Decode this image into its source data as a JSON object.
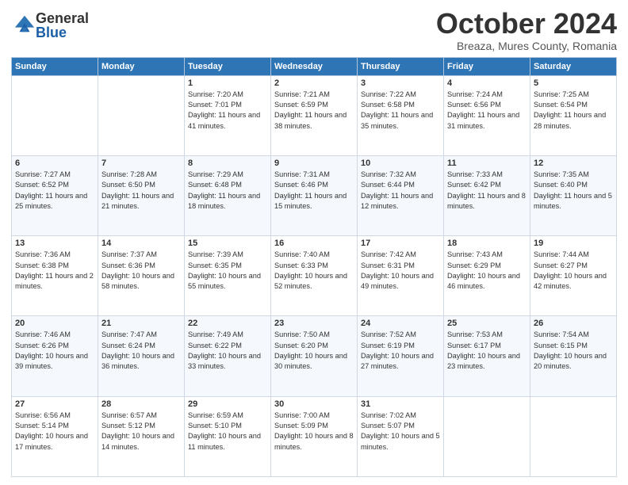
{
  "header": {
    "logo_general": "General",
    "logo_blue": "Blue",
    "month_title": "October 2024",
    "location": "Breaza, Mures County, Romania"
  },
  "days_of_week": [
    "Sunday",
    "Monday",
    "Tuesday",
    "Wednesday",
    "Thursday",
    "Friday",
    "Saturday"
  ],
  "weeks": [
    [
      {
        "day": "",
        "sunrise": "",
        "sunset": "",
        "daylight": ""
      },
      {
        "day": "",
        "sunrise": "",
        "sunset": "",
        "daylight": ""
      },
      {
        "day": "1",
        "sunrise": "Sunrise: 7:20 AM",
        "sunset": "Sunset: 7:01 PM",
        "daylight": "Daylight: 11 hours and 41 minutes."
      },
      {
        "day": "2",
        "sunrise": "Sunrise: 7:21 AM",
        "sunset": "Sunset: 6:59 PM",
        "daylight": "Daylight: 11 hours and 38 minutes."
      },
      {
        "day": "3",
        "sunrise": "Sunrise: 7:22 AM",
        "sunset": "Sunset: 6:58 PM",
        "daylight": "Daylight: 11 hours and 35 minutes."
      },
      {
        "day": "4",
        "sunrise": "Sunrise: 7:24 AM",
        "sunset": "Sunset: 6:56 PM",
        "daylight": "Daylight: 11 hours and 31 minutes."
      },
      {
        "day": "5",
        "sunrise": "Sunrise: 7:25 AM",
        "sunset": "Sunset: 6:54 PM",
        "daylight": "Daylight: 11 hours and 28 minutes."
      }
    ],
    [
      {
        "day": "6",
        "sunrise": "Sunrise: 7:27 AM",
        "sunset": "Sunset: 6:52 PM",
        "daylight": "Daylight: 11 hours and 25 minutes."
      },
      {
        "day": "7",
        "sunrise": "Sunrise: 7:28 AM",
        "sunset": "Sunset: 6:50 PM",
        "daylight": "Daylight: 11 hours and 21 minutes."
      },
      {
        "day": "8",
        "sunrise": "Sunrise: 7:29 AM",
        "sunset": "Sunset: 6:48 PM",
        "daylight": "Daylight: 11 hours and 18 minutes."
      },
      {
        "day": "9",
        "sunrise": "Sunrise: 7:31 AM",
        "sunset": "Sunset: 6:46 PM",
        "daylight": "Daylight: 11 hours and 15 minutes."
      },
      {
        "day": "10",
        "sunrise": "Sunrise: 7:32 AM",
        "sunset": "Sunset: 6:44 PM",
        "daylight": "Daylight: 11 hours and 12 minutes."
      },
      {
        "day": "11",
        "sunrise": "Sunrise: 7:33 AM",
        "sunset": "Sunset: 6:42 PM",
        "daylight": "Daylight: 11 hours and 8 minutes."
      },
      {
        "day": "12",
        "sunrise": "Sunrise: 7:35 AM",
        "sunset": "Sunset: 6:40 PM",
        "daylight": "Daylight: 11 hours and 5 minutes."
      }
    ],
    [
      {
        "day": "13",
        "sunrise": "Sunrise: 7:36 AM",
        "sunset": "Sunset: 6:38 PM",
        "daylight": "Daylight: 11 hours and 2 minutes."
      },
      {
        "day": "14",
        "sunrise": "Sunrise: 7:37 AM",
        "sunset": "Sunset: 6:36 PM",
        "daylight": "Daylight: 10 hours and 58 minutes."
      },
      {
        "day": "15",
        "sunrise": "Sunrise: 7:39 AM",
        "sunset": "Sunset: 6:35 PM",
        "daylight": "Daylight: 10 hours and 55 minutes."
      },
      {
        "day": "16",
        "sunrise": "Sunrise: 7:40 AM",
        "sunset": "Sunset: 6:33 PM",
        "daylight": "Daylight: 10 hours and 52 minutes."
      },
      {
        "day": "17",
        "sunrise": "Sunrise: 7:42 AM",
        "sunset": "Sunset: 6:31 PM",
        "daylight": "Daylight: 10 hours and 49 minutes."
      },
      {
        "day": "18",
        "sunrise": "Sunrise: 7:43 AM",
        "sunset": "Sunset: 6:29 PM",
        "daylight": "Daylight: 10 hours and 46 minutes."
      },
      {
        "day": "19",
        "sunrise": "Sunrise: 7:44 AM",
        "sunset": "Sunset: 6:27 PM",
        "daylight": "Daylight: 10 hours and 42 minutes."
      }
    ],
    [
      {
        "day": "20",
        "sunrise": "Sunrise: 7:46 AM",
        "sunset": "Sunset: 6:26 PM",
        "daylight": "Daylight: 10 hours and 39 minutes."
      },
      {
        "day": "21",
        "sunrise": "Sunrise: 7:47 AM",
        "sunset": "Sunset: 6:24 PM",
        "daylight": "Daylight: 10 hours and 36 minutes."
      },
      {
        "day": "22",
        "sunrise": "Sunrise: 7:49 AM",
        "sunset": "Sunset: 6:22 PM",
        "daylight": "Daylight: 10 hours and 33 minutes."
      },
      {
        "day": "23",
        "sunrise": "Sunrise: 7:50 AM",
        "sunset": "Sunset: 6:20 PM",
        "daylight": "Daylight: 10 hours and 30 minutes."
      },
      {
        "day": "24",
        "sunrise": "Sunrise: 7:52 AM",
        "sunset": "Sunset: 6:19 PM",
        "daylight": "Daylight: 10 hours and 27 minutes."
      },
      {
        "day": "25",
        "sunrise": "Sunrise: 7:53 AM",
        "sunset": "Sunset: 6:17 PM",
        "daylight": "Daylight: 10 hours and 23 minutes."
      },
      {
        "day": "26",
        "sunrise": "Sunrise: 7:54 AM",
        "sunset": "Sunset: 6:15 PM",
        "daylight": "Daylight: 10 hours and 20 minutes."
      }
    ],
    [
      {
        "day": "27",
        "sunrise": "Sunrise: 6:56 AM",
        "sunset": "Sunset: 5:14 PM",
        "daylight": "Daylight: 10 hours and 17 minutes."
      },
      {
        "day": "28",
        "sunrise": "Sunrise: 6:57 AM",
        "sunset": "Sunset: 5:12 PM",
        "daylight": "Daylight: 10 hours and 14 minutes."
      },
      {
        "day": "29",
        "sunrise": "Sunrise: 6:59 AM",
        "sunset": "Sunset: 5:10 PM",
        "daylight": "Daylight: 10 hours and 11 minutes."
      },
      {
        "day": "30",
        "sunrise": "Sunrise: 7:00 AM",
        "sunset": "Sunset: 5:09 PM",
        "daylight": "Daylight: 10 hours and 8 minutes."
      },
      {
        "day": "31",
        "sunrise": "Sunrise: 7:02 AM",
        "sunset": "Sunset: 5:07 PM",
        "daylight": "Daylight: 10 hours and 5 minutes."
      },
      {
        "day": "",
        "sunrise": "",
        "sunset": "",
        "daylight": ""
      },
      {
        "day": "",
        "sunrise": "",
        "sunset": "",
        "daylight": ""
      }
    ]
  ]
}
